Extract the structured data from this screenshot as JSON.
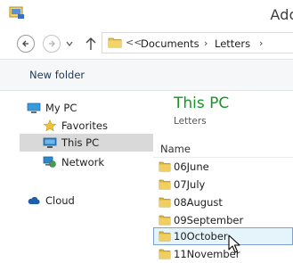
{
  "window": {
    "title_partial": "Add"
  },
  "address_bar": {
    "overflow_marker": "<<",
    "crumbs": [
      "Documents",
      "Letters"
    ]
  },
  "toolbar": {
    "new_folder_label": "New folder"
  },
  "sidebar": {
    "items": [
      {
        "label": "My PC",
        "icon": "computer-icon"
      },
      {
        "label": "Favorites",
        "icon": "star-icon"
      },
      {
        "label": "This PC",
        "icon": "computer-icon",
        "selected": true
      },
      {
        "label": "Network",
        "icon": "network-icon"
      },
      {
        "label": "Cloud",
        "icon": "cloud-icon"
      }
    ]
  },
  "content": {
    "heading": "This PC",
    "subheading": "Letters",
    "column_header": "Name",
    "folders": [
      "06June",
      "07July",
      "08August",
      "09September",
      "10October",
      "11November"
    ],
    "hovered_folder": "10October"
  },
  "colors": {
    "heading_green": "#199428",
    "hover_bg": "#e5f3fb",
    "hover_border": "#7da2ce",
    "selected_bg": "#d9d9d9",
    "folder_yellow": "#e8c24e"
  }
}
